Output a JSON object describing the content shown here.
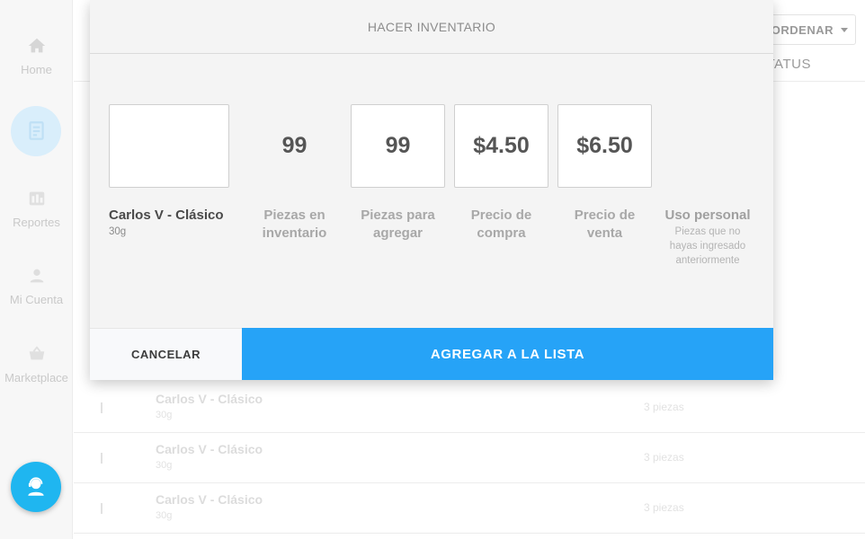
{
  "sidebar": {
    "items": [
      {
        "label": "Home",
        "icon": "home-icon"
      },
      {
        "label": "",
        "icon": "inventory-icon"
      },
      {
        "label": "Reportes",
        "icon": "reports-icon"
      },
      {
        "label": "Mi Cuenta",
        "icon": "account-icon"
      },
      {
        "label": "Marketplace",
        "icon": "marketplace-icon"
      }
    ],
    "fab_icon": "support-agent-icon"
  },
  "toolbar": {
    "sort_label": "ORDENAR"
  },
  "table": {
    "status_header": "STATUS",
    "rows": [
      {
        "name": "Carlos V - Clásico",
        "weight": "30g",
        "qty": "3 piezas"
      },
      {
        "name": "Carlos V - Clásico",
        "weight": "30g",
        "qty": "3 piezas"
      },
      {
        "name": "Carlos V - Clásico",
        "weight": "30g",
        "qty": "3 piezas"
      }
    ]
  },
  "modal": {
    "title": "HACER INVENTARIO",
    "product": {
      "name": "Carlos V - Clásico",
      "weight": "30g"
    },
    "fields": {
      "in_stock": {
        "value": "99",
        "label_line1": "Piezas en",
        "label_line2": "inventario"
      },
      "to_add": {
        "value": "99",
        "label_line1": "Piezas para",
        "label_line2": "agregar"
      },
      "buy_price": {
        "value": "$4.50",
        "label_line1": "Precio de",
        "label_line2": "compra"
      },
      "sell_price": {
        "value": "$6.50",
        "label_line1": "Precio de",
        "label_line2": "venta"
      },
      "personal_use": {
        "label": "Uso personal",
        "hint_line1": "Piezas que no",
        "hint_line2": "hayas ingresado",
        "hint_line3": "anteriormente"
      }
    },
    "cancel_label": "CANCELAR",
    "add_label": "AGREGAR A LA LISTA"
  },
  "colors": {
    "accent": "#26a3f7",
    "fab": "#1fb6f0"
  }
}
